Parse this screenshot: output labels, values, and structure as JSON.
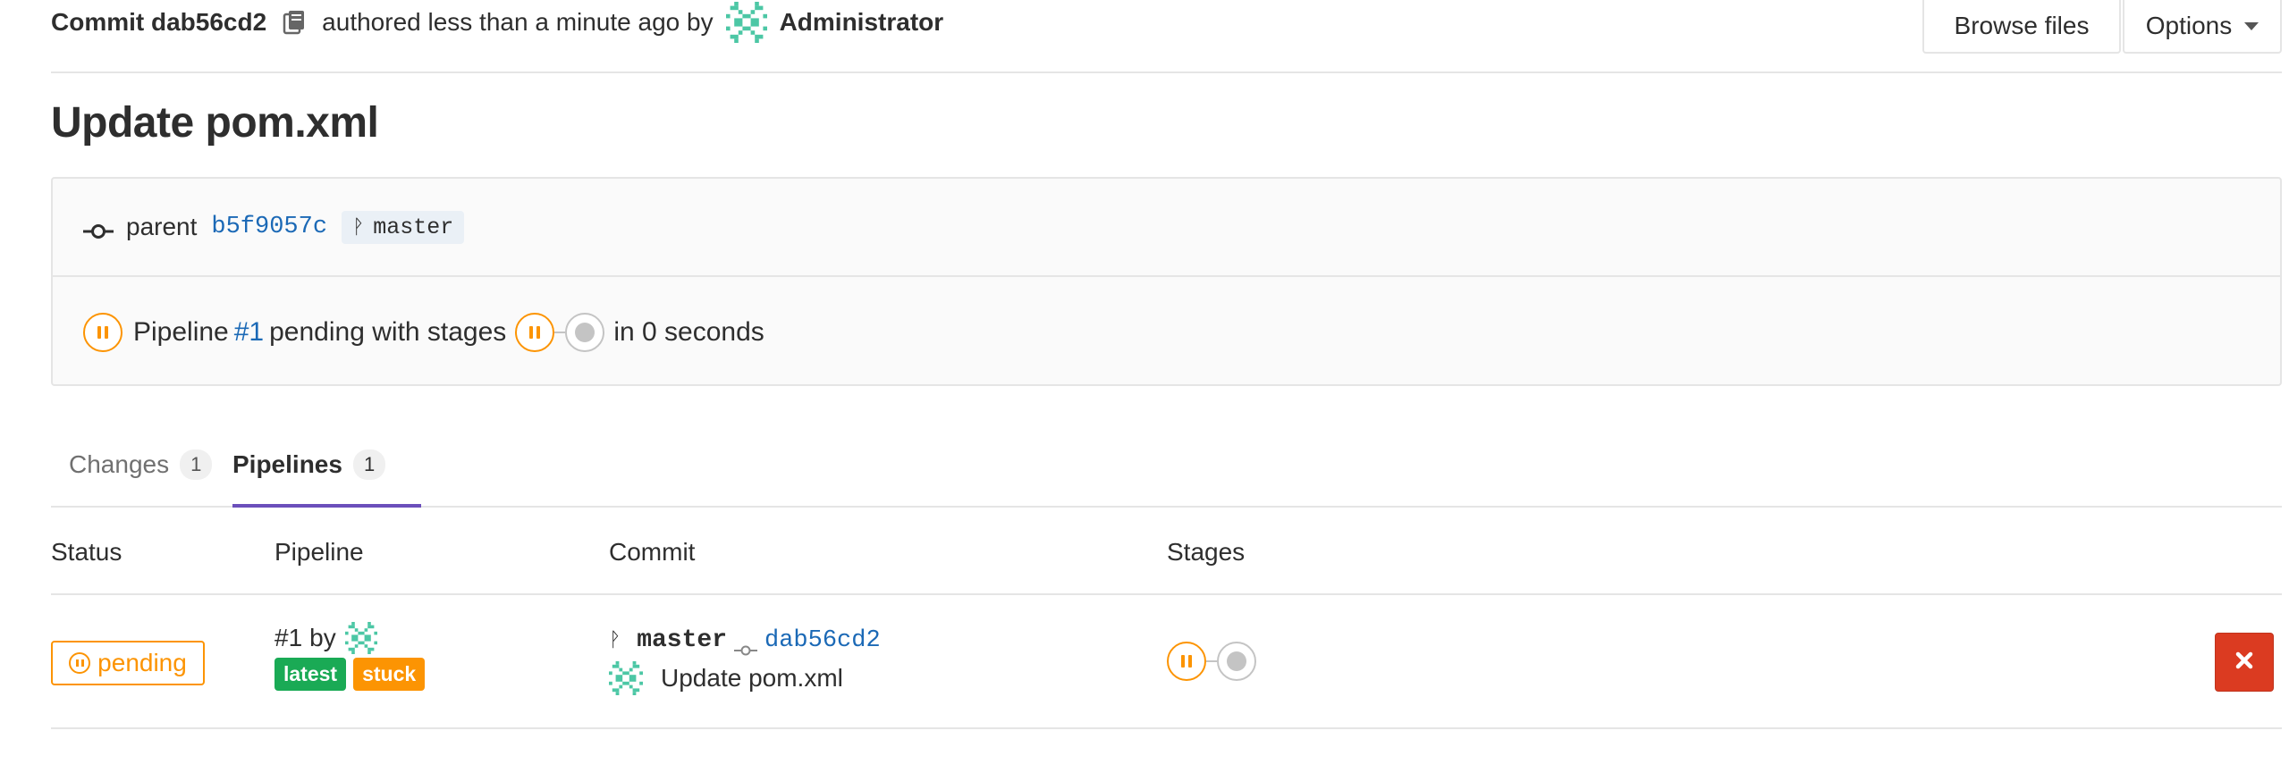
{
  "header": {
    "commit_title": "Commit dab56cd2",
    "copy_icon": "clipboard-icon",
    "authored_text": "authored less than a minute ago by",
    "author_name": "Administrator",
    "browse_files_label": "Browse files",
    "options_label": "Options"
  },
  "title": "Update pom.xml",
  "info": {
    "parent_label": "parent",
    "parent_sha": "b5f9057c",
    "branch": "master",
    "pipeline_prefix": "Pipeline",
    "pipeline_id": "#1",
    "pipeline_middle": "pending with stages",
    "pipeline_suffix": "in 0 seconds"
  },
  "tabs": [
    {
      "label": "Changes",
      "count": "1"
    },
    {
      "label": "Pipelines",
      "count": "1"
    }
  ],
  "table": {
    "headers": {
      "status": "Status",
      "pipeline": "Pipeline",
      "commit": "Commit",
      "stages": "Stages"
    },
    "rows": [
      {
        "status": "pending",
        "pipeline_id": "#1",
        "by": "by",
        "labels": {
          "latest": "latest",
          "stuck": "stuck"
        },
        "branch": "master",
        "sha": "dab56cd2",
        "message": "Update pom.xml"
      }
    ]
  },
  "colors": {
    "pending": "#fc9403",
    "link": "#1b69b6",
    "tab_active": "#6b4fbb",
    "label_latest": "#1aaa55",
    "label_stuck": "#fc9403",
    "cancel": "#db3b21"
  }
}
